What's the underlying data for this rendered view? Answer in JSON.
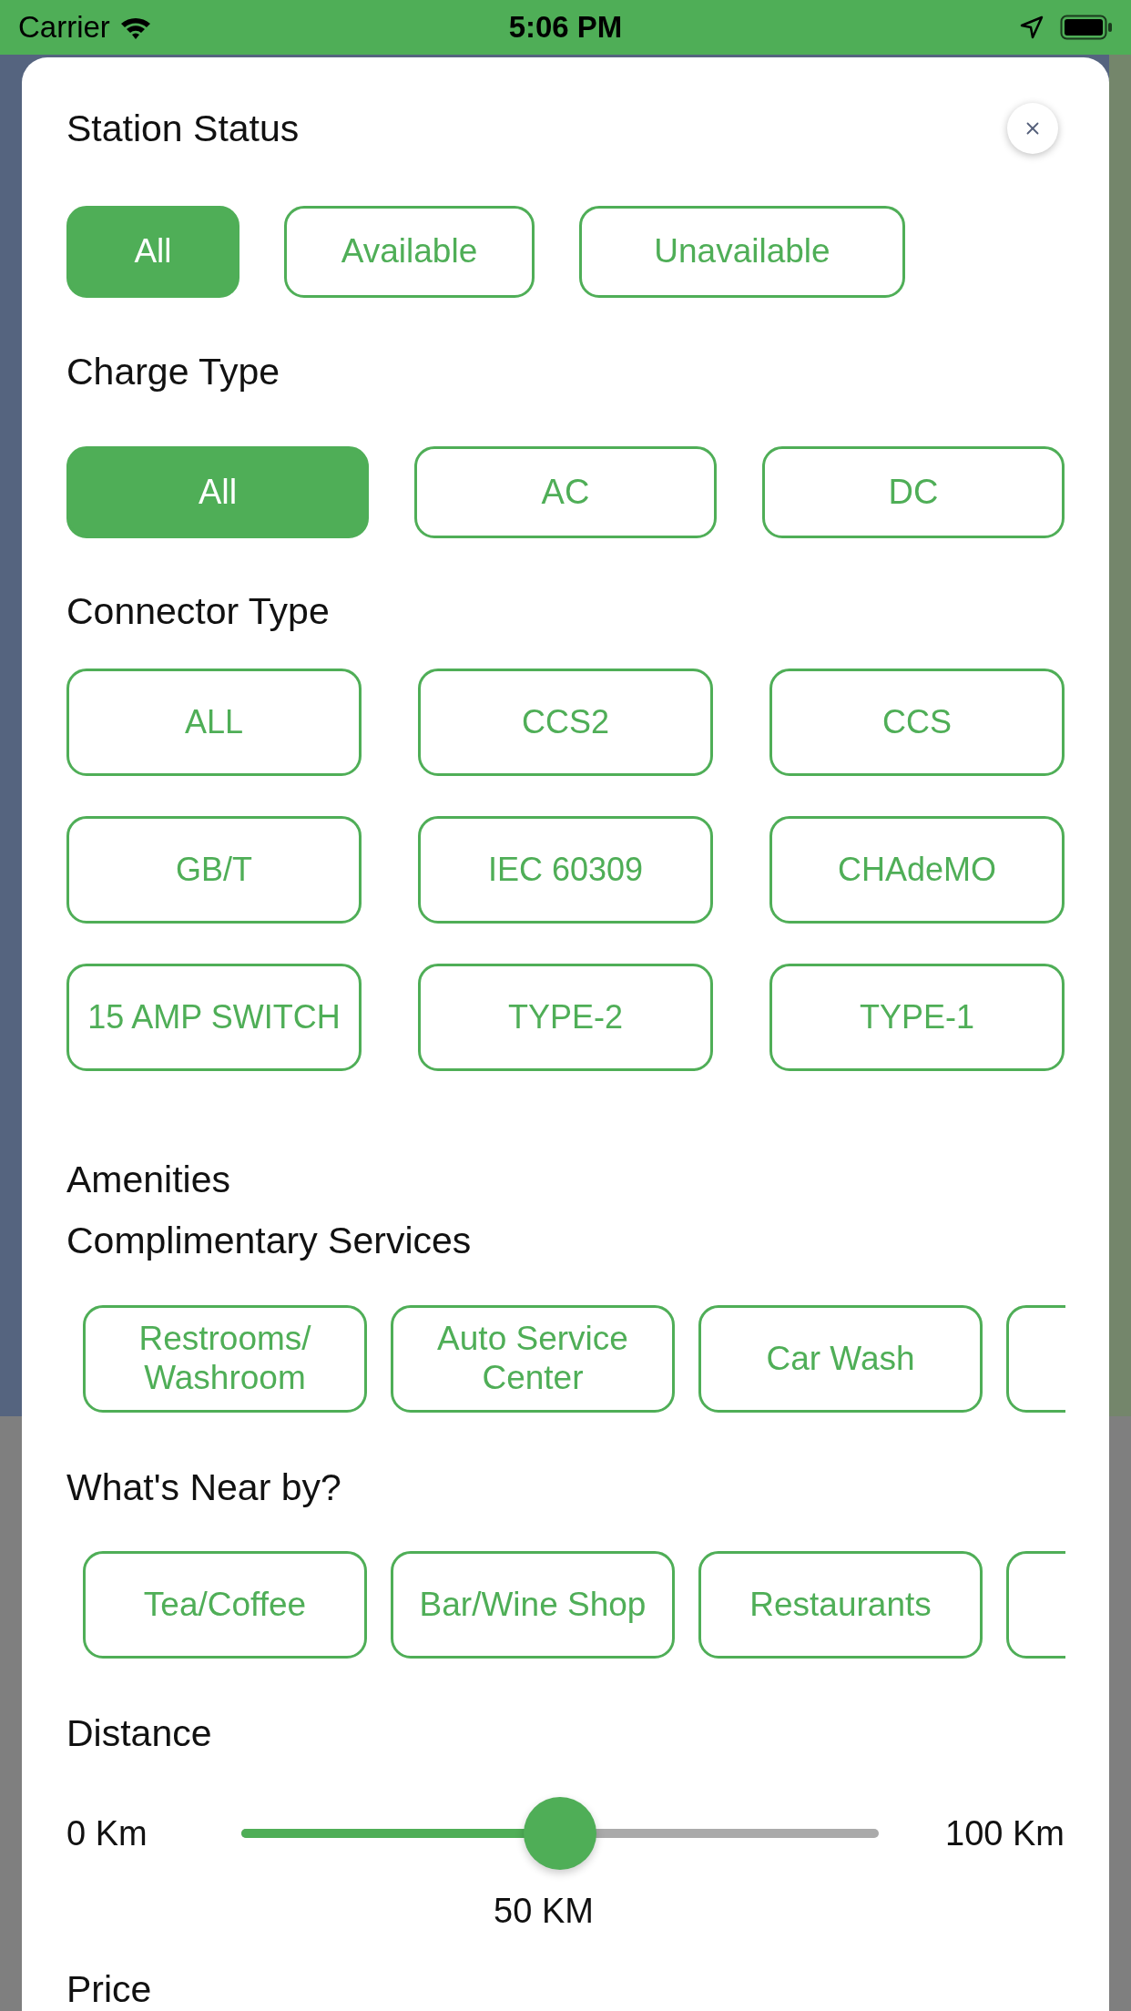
{
  "status_bar": {
    "carrier": "Carrier",
    "time": "5:06 PM"
  },
  "station_status": {
    "title": "Station Status",
    "options": [
      {
        "label": "All",
        "selected": true
      },
      {
        "label": "Available",
        "selected": false
      },
      {
        "label": "Unavailable",
        "selected": false
      }
    ]
  },
  "charge_type": {
    "title": "Charge Type",
    "options": [
      {
        "label": "All",
        "selected": true
      },
      {
        "label": "AC",
        "selected": false
      },
      {
        "label": "DC",
        "selected": false
      }
    ]
  },
  "connector_type": {
    "title": "Connector Type",
    "options": [
      {
        "label": "ALL",
        "selected": false
      },
      {
        "label": "CCS2",
        "selected": false
      },
      {
        "label": "CCS",
        "selected": false
      },
      {
        "label": "GB/T",
        "selected": false
      },
      {
        "label": "IEC 60309",
        "selected": false
      },
      {
        "label": "CHAdeMO",
        "selected": false
      },
      {
        "label": "15 AMP SWITCH",
        "selected": false
      },
      {
        "label": "TYPE-2",
        "selected": false
      },
      {
        "label": "TYPE-1",
        "selected": false
      }
    ]
  },
  "amenities": {
    "title": "Amenities",
    "groups": [
      {
        "title": "Complimentary Services",
        "options": [
          {
            "kind": "chip",
            "label": "Restrooms/ Washroom",
            "selected": false
          },
          {
            "kind": "chip",
            "label": "Auto Service Center",
            "selected": false
          },
          {
            "kind": "chip",
            "label": "Car Wash",
            "selected": false
          },
          {
            "kind": "partial",
            "selected": false
          }
        ]
      },
      {
        "title": "What's Near by?",
        "options": [
          {
            "kind": "chip",
            "label": "Tea/Coffee",
            "selected": false
          },
          {
            "kind": "chip",
            "label": "Bar/Wine Shop",
            "selected": false
          },
          {
            "kind": "chip",
            "label": "Restaurants",
            "selected": false
          },
          {
            "kind": "partial",
            "selected": false
          }
        ]
      }
    ]
  },
  "distance": {
    "title": "Distance",
    "min_label": "0 Km",
    "max_label": "100 Km",
    "value_label": "50 KM",
    "level": 0.5
  },
  "price": {
    "title": "Price"
  }
}
